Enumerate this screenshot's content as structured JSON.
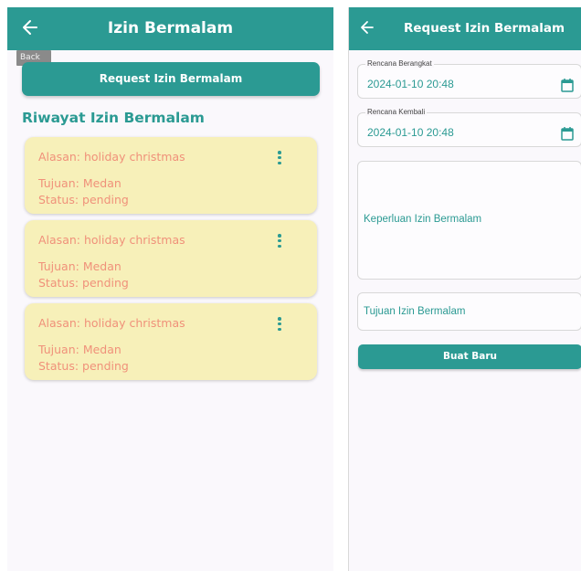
{
  "list_screen": {
    "title": "Izin Bermalam",
    "back_tooltip": "Back",
    "request_button": "Request Izin Bermalam",
    "section_title": "Riwayat Izin Bermalam",
    "items": [
      {
        "alasan": "Alasan: holiday christmas",
        "tujuan": "Tujuan: Medan",
        "status": "Status: pending"
      },
      {
        "alasan": "Alasan: holiday christmas",
        "tujuan": "Tujuan: Medan",
        "status": "Status: pending"
      },
      {
        "alasan": "Alasan: holiday christmas",
        "tujuan": "Tujuan: Medan",
        "status": "Status: pending"
      }
    ]
  },
  "form_screen": {
    "title": "Request Izin Bermalam",
    "berangkat": {
      "label": "Rencana Berangkat",
      "value": "2024-01-10 20:48"
    },
    "kembali": {
      "label": "Rencana Kembali",
      "value": "2024-01-10 20:48"
    },
    "keperluan_placeholder": "Keperluan Izin Bermalam",
    "tujuan_placeholder": "Tujuan Izin Bermalam",
    "submit_button": "Buat Baru"
  },
  "colors": {
    "primary": "#2b9a93",
    "card_bg": "#f7f0b9",
    "card_text": "#f0917a"
  },
  "icons": [
    "back-arrow-icon",
    "more-vert-icon",
    "calendar-icon"
  ]
}
